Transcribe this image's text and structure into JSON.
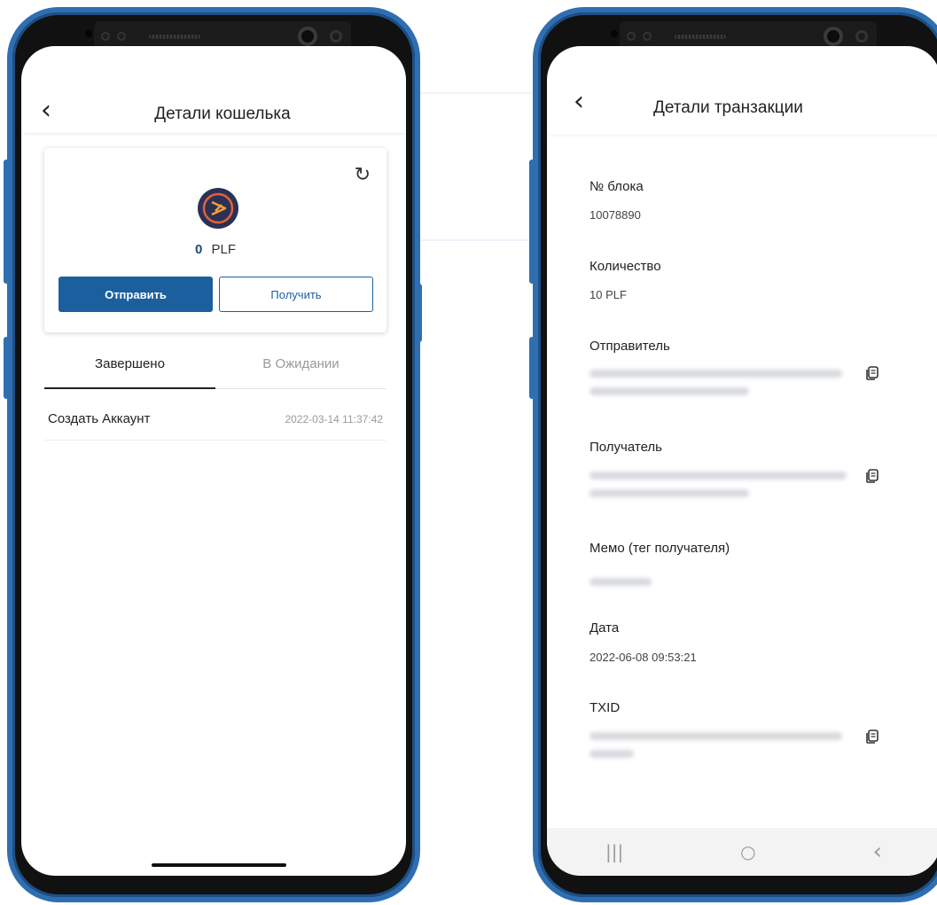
{
  "wallet_screen": {
    "header": {
      "back_icon": "chevron-left-icon",
      "title": "Детали кошелька"
    },
    "card": {
      "refresh_icon": "refresh-icon",
      "coin_icon": "coin-logo-icon",
      "balance_amount": "0",
      "balance_symbol": "PLF",
      "send_label": "Отправить",
      "receive_label": "Получить"
    },
    "tabs": [
      {
        "label": "Завершено",
        "active": true
      },
      {
        "label": "В Ожидании",
        "active": false
      }
    ],
    "transactions": [
      {
        "name": "Создать Аккаунт",
        "date": "2022-03-14 11:37:42"
      }
    ]
  },
  "transaction_screen": {
    "header": {
      "back_icon": "chevron-left-icon",
      "title": "Детали транзакции"
    },
    "fields": {
      "block": {
        "label": "№ блока",
        "value": "10078890"
      },
      "amount": {
        "label": "Количество",
        "value": "10 PLF"
      },
      "sender": {
        "label": "Отправитель",
        "copy_icon": "copy-icon"
      },
      "recipient": {
        "label": "Получатель",
        "copy_icon": "copy-icon"
      },
      "memo": {
        "label": "Мемо (тег получателя)"
      },
      "date": {
        "label": "Дата",
        "value": "2022-06-08 09:53:21"
      },
      "txid": {
        "label": "TXID",
        "copy_icon": "copy-icon"
      }
    },
    "nav": {
      "recents_icon": "recents-icon",
      "recents_glyph": "|||",
      "home_icon": "home-icon",
      "home_glyph": "○",
      "back_icon": "back-icon",
      "back_glyph": "‹"
    }
  },
  "colors": {
    "accent": "#1b5f9e",
    "phone_frame": "#2f6fb1",
    "muted_text": "#9a9a9a"
  }
}
